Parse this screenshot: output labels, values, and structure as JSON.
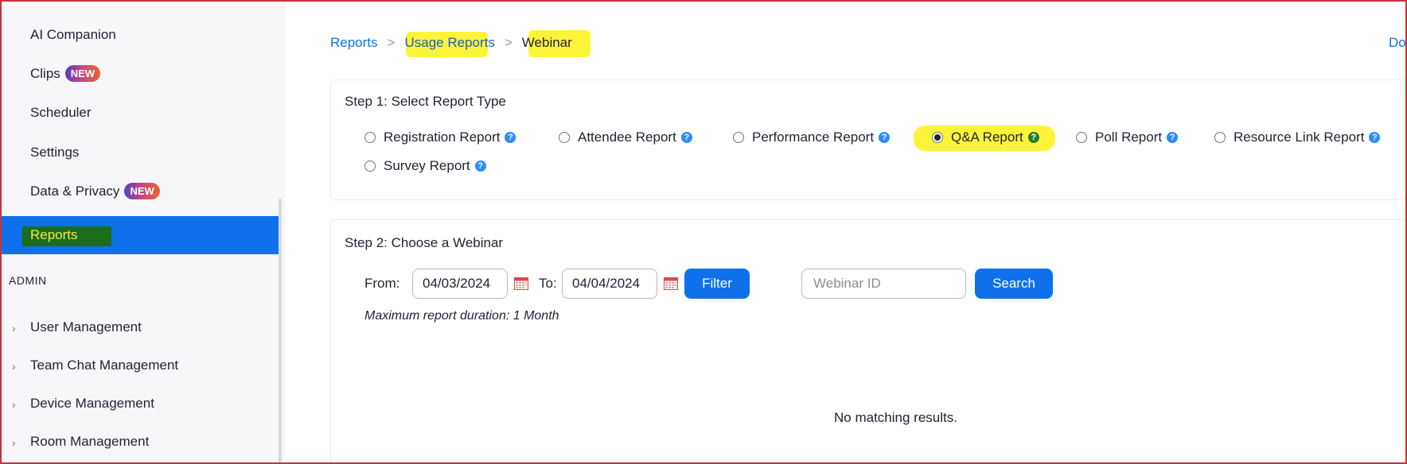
{
  "sidebar": {
    "items": [
      {
        "label": "AI Companion"
      },
      {
        "label": "Clips",
        "badge": "NEW"
      },
      {
        "label": "Scheduler"
      },
      {
        "label": "Settings"
      },
      {
        "label": "Data & Privacy",
        "badge": "NEW"
      }
    ],
    "active_item": "Reports",
    "admin_title": "ADMIN",
    "admin_items": [
      {
        "label": "User Management"
      },
      {
        "label": "Team Chat Management"
      },
      {
        "label": "Device Management"
      },
      {
        "label": "Room Management"
      }
    ]
  },
  "breadcrumb": {
    "items": [
      "Reports",
      "Usage Reports",
      "Webinar"
    ],
    "separator": ">"
  },
  "header": {
    "download_label": "Do"
  },
  "step1": {
    "title": "Step 1: Select Report Type",
    "options": [
      {
        "label": "Registration Report",
        "checked": false
      },
      {
        "label": "Attendee Report",
        "checked": false
      },
      {
        "label": "Performance Report",
        "checked": false
      },
      {
        "label": "Q&A Report",
        "checked": true
      },
      {
        "label": "Poll Report",
        "checked": false
      },
      {
        "label": "Resource Link Report",
        "checked": false
      },
      {
        "label": "Survey Report",
        "checked": false
      }
    ],
    "help_glyph": "?"
  },
  "step2": {
    "title": "Step 2: Choose a Webinar",
    "from_label": "From:",
    "from_value": "04/03/2024",
    "to_label": "To:",
    "to_value": "04/04/2024",
    "filter_label": "Filter",
    "webinar_id_placeholder": "Webinar ID",
    "search_label": "Search",
    "max_duration_note": "Maximum report duration: 1 Month",
    "empty_message": "No matching results."
  },
  "colors": {
    "accent": "#0e71eb",
    "highlight_yellow": "#fdf43a",
    "highlight_green": "#1a6e1c",
    "frame_border": "#c6323c"
  }
}
